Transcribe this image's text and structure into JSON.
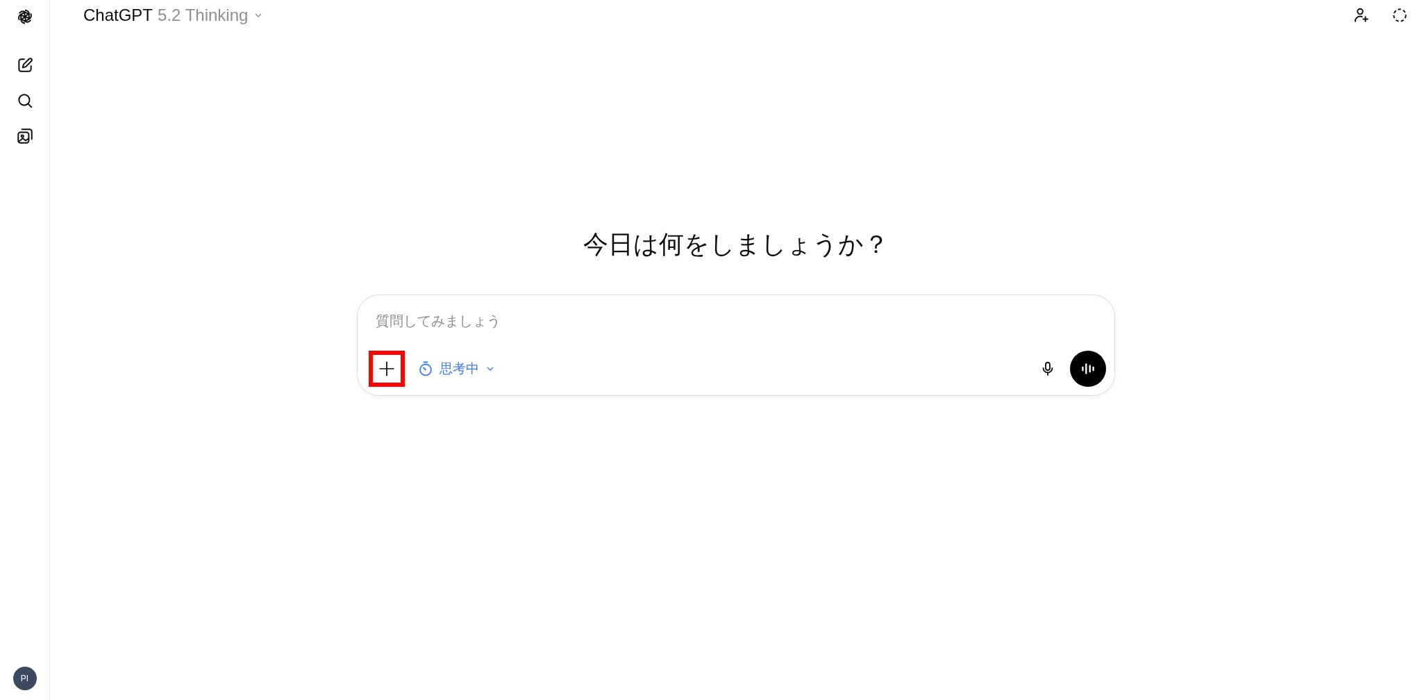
{
  "header": {
    "model_name": "ChatGPT",
    "model_version": "5.2 Thinking"
  },
  "sidebar": {
    "avatar": "PI"
  },
  "heading": "今日は何をしましょうか？",
  "composer": {
    "placeholder": "質問してみましょう",
    "add_highlighted": true,
    "mode_label": "思考中"
  }
}
